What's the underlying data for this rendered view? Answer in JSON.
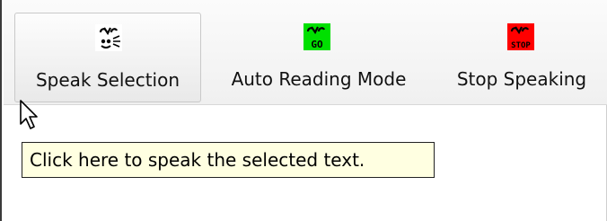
{
  "toolbar": {
    "buttons": [
      {
        "label": "Speak Selection",
        "icon": "speak-selection-icon"
      },
      {
        "label": "Auto Reading Mode",
        "icon": "auto-reading-mode-icon",
        "icon_text": "GO",
        "color": "#00e000"
      },
      {
        "label": "Stop Speaking",
        "icon": "stop-speaking-icon",
        "icon_text": "STOP",
        "color": "#ff0000"
      }
    ],
    "hovered_button": "Speak Selection"
  },
  "tooltip": {
    "text": "Click here to speak the selected text."
  },
  "cursor": "arrow-cursor"
}
